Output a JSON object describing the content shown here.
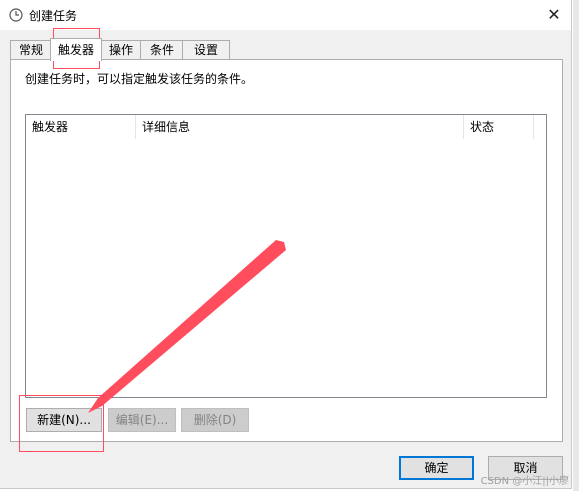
{
  "window": {
    "title": "创建任务"
  },
  "tabs": [
    {
      "label": "常规"
    },
    {
      "label": "触发器"
    },
    {
      "label": "操作"
    },
    {
      "label": "条件"
    },
    {
      "label": "设置"
    }
  ],
  "panel": {
    "description": "创建任务时，可以指定触发该任务的条件。",
    "columns": [
      "触发器",
      "详细信息",
      "状态"
    ],
    "rows": []
  },
  "buttons": {
    "new": "新建(N)...",
    "edit": "编辑(E)...",
    "delete": "删除(D)"
  },
  "footer": {
    "ok": "确定",
    "cancel": "取消"
  },
  "watermark": "CSDN @小江||小廖",
  "colors": {
    "annotation": "#ff4d5e",
    "accent": "#0078d7"
  }
}
